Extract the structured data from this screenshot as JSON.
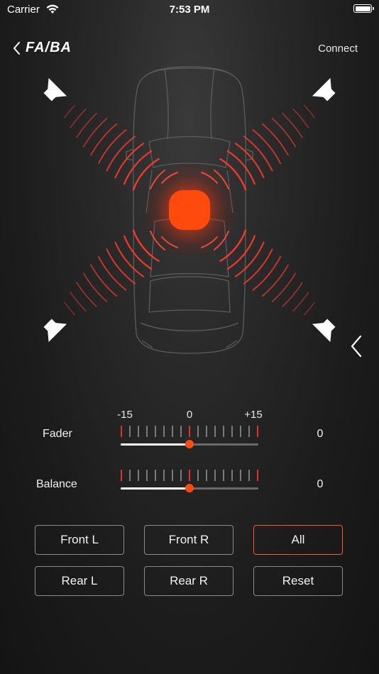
{
  "status_bar": {
    "carrier": "Carrier",
    "time": "7:53 PM"
  },
  "header": {
    "title": "FA/BA",
    "connect_label": "Connect"
  },
  "accent_color": "#ff4a12",
  "scale": {
    "min_label": "-15",
    "mid_label": "0",
    "max_label": "+15",
    "min": -15,
    "max": 15
  },
  "fader": {
    "label": "Fader",
    "value": "0",
    "numeric": 0
  },
  "balance": {
    "label": "Balance",
    "value": "0",
    "numeric": 0
  },
  "buttons": [
    {
      "label": "Front L",
      "active": false
    },
    {
      "label": "Front R",
      "active": false
    },
    {
      "label": "All",
      "active": true
    },
    {
      "label": "Rear L",
      "active": false
    },
    {
      "label": "Rear R",
      "active": false
    },
    {
      "label": "Reset",
      "active": false
    }
  ],
  "icons": [
    "back-chevron-icon",
    "wifi-icon",
    "battery-icon",
    "speaker-icon",
    "side-chevron-icon"
  ]
}
